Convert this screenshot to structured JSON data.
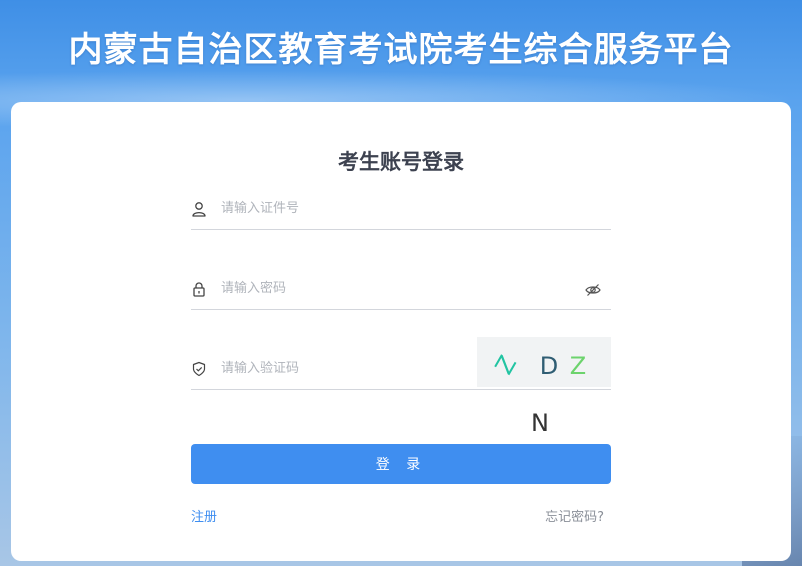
{
  "header": {
    "title": "内蒙古自治区教育考试院考生综合服务平台"
  },
  "login": {
    "title": "考生账号登录",
    "id_field": {
      "placeholder": "请输入证件号",
      "value": ""
    },
    "password_field": {
      "placeholder": "请输入密码",
      "value": ""
    },
    "captcha_field": {
      "placeholder": "请输入验证码",
      "value": ""
    },
    "captcha_chars": [
      "Z",
      "D",
      "Z",
      "N"
    ],
    "submit_label": "登 录",
    "register_label": "注册",
    "forgot_label": "忘记密码?"
  },
  "icons": {
    "id_field": "user-icon",
    "password_field": "lock-icon",
    "captcha_field": "shield-icon",
    "toggle_password": "eye-off-icon"
  },
  "colors": {
    "primary": "#3f8ef0",
    "title_text": "#3d4250",
    "captcha_z1": "#22c4a2",
    "captcha_d": "#2f5d73",
    "captcha_z2": "#6cd36c"
  }
}
